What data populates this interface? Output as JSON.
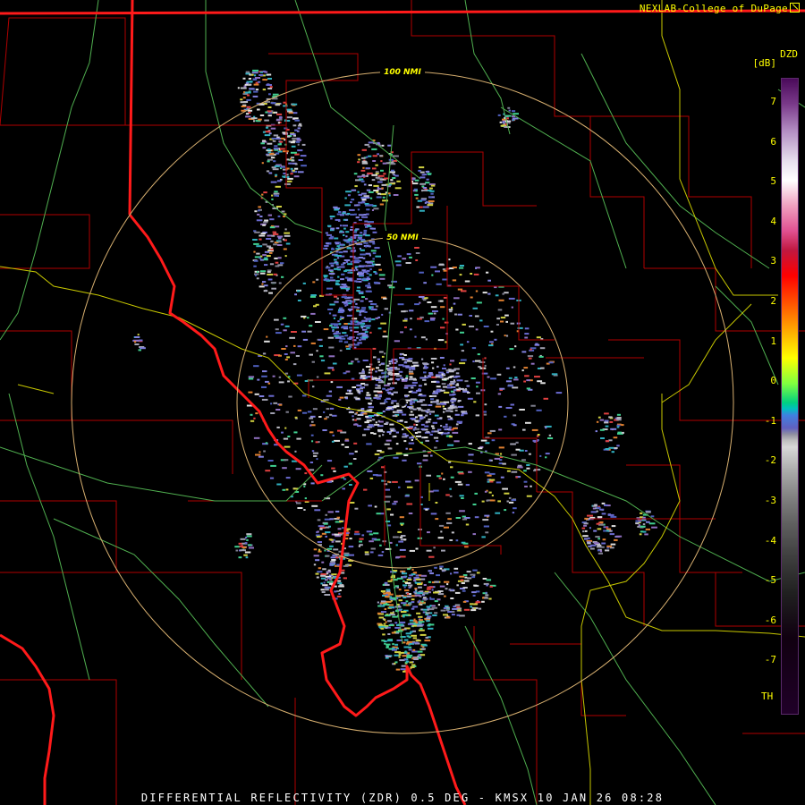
{
  "credit": "NEXLAB-College of DuPage",
  "footer": "DIFFERENTIAL REFLECTIVITY (ZDR) 0.5 DEG - KMSX 10 JAN 26 08:28",
  "legend": {
    "product": "DZD",
    "unit": "[dB]",
    "ticks": [
      "7",
      "6",
      "5",
      "4",
      "3",
      "2",
      "1",
      "0",
      "-1",
      "-2",
      "-3",
      "-4",
      "-5",
      "-6",
      "-7"
    ],
    "th_label": "TH"
  },
  "range_rings": {
    "outer": "100 NMI",
    "inner": "50 NMI"
  },
  "colors": {
    "state_border": "#ff2020",
    "county_border": "#c00000",
    "highway": "#d0d000",
    "river": "#60c060",
    "range_ring": "#d8b070",
    "radar_site": "#000000"
  }
}
